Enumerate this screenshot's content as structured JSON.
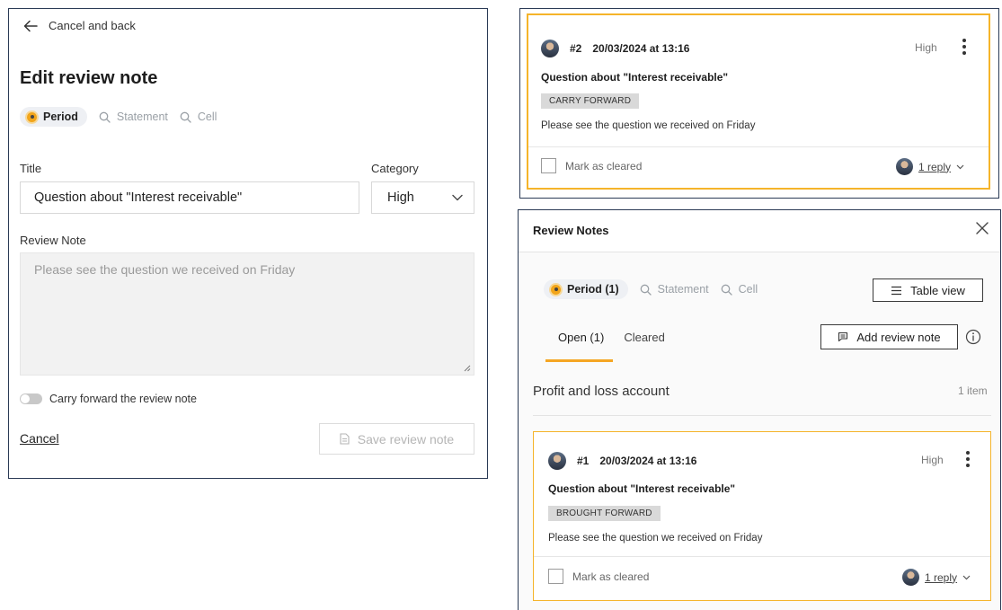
{
  "edit_panel": {
    "back_label": "Cancel and back",
    "title": "Edit review note",
    "scope": {
      "period": "Period",
      "statement": "Statement",
      "cell": "Cell"
    },
    "title_label": "Title",
    "title_value": "Question about \"Interest receivable\"",
    "category_label": "Category",
    "category_value": "High",
    "review_note_label": "Review Note",
    "review_note_placeholder": "Please see the question we received on Friday",
    "carry_forward_label": "Carry forward the review note",
    "cancel_label": "Cancel",
    "save_label": "Save review note"
  },
  "top_card": {
    "number": "#2",
    "date": "20/03/2024 at 13:16",
    "priority": "High",
    "question": "Question about \"Interest receivable\"",
    "tag": "CARRY FORWARD",
    "body": "Please see the question we received on Friday",
    "mark_cleared": "Mark as cleared",
    "reply": "1 reply"
  },
  "review_panel": {
    "title": "Review Notes",
    "scope": {
      "period": "Period (1)",
      "statement": "Statement",
      "cell": "Cell"
    },
    "table_view": "Table view",
    "tabs": [
      {
        "label": "Open (1)"
      },
      {
        "label": "Cleared"
      }
    ],
    "add_note": "Add review note",
    "section_title": "Profit and loss account",
    "section_count": "1 item",
    "card": {
      "number": "#1",
      "date": "20/03/2024 at 13:16",
      "priority": "High",
      "question": "Question about \"Interest receivable\"",
      "tag": "BROUGHT FORWARD",
      "body": "Please see the question we received on Friday",
      "mark_cleared": "Mark as cleared",
      "reply": "1 reply"
    }
  },
  "colors": {
    "accent": "#f5a623",
    "card_border": "#f5b42a",
    "panel_border": "#2a3a55"
  },
  "icons": [
    "arrow-left-icon",
    "search-icon",
    "chevron-down-icon",
    "document-icon",
    "kebab-icon",
    "close-icon",
    "list-icon",
    "comment-icon",
    "info-icon"
  ]
}
